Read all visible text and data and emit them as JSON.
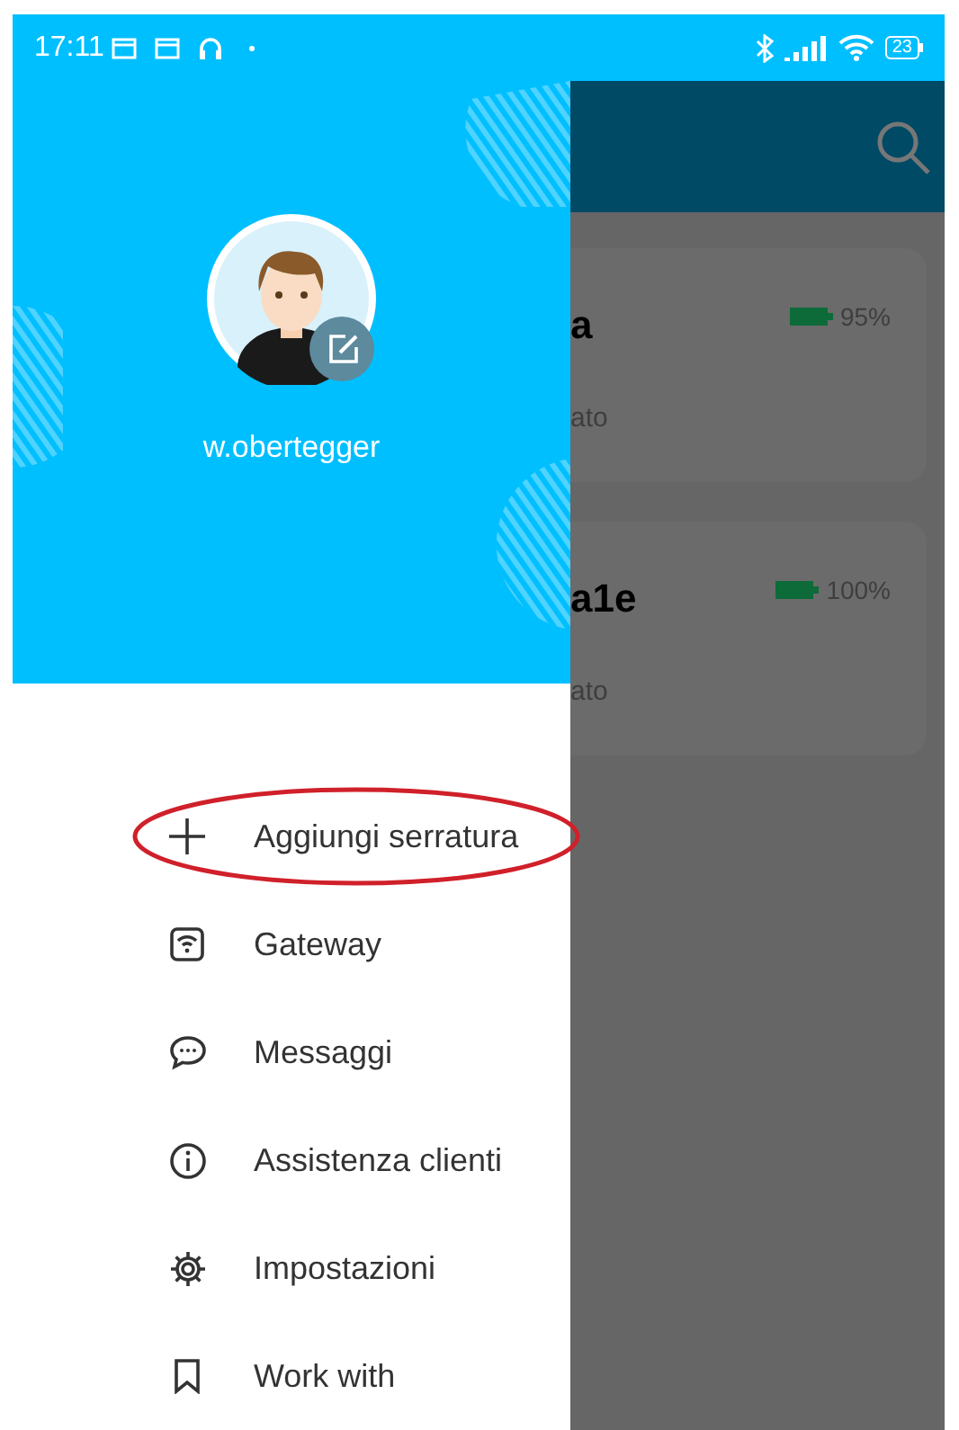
{
  "status_bar": {
    "time": "17:11",
    "battery": "23"
  },
  "drawer": {
    "username": "w.obertegger",
    "menu": [
      {
        "kind": "plus",
        "label": "Aggiungi serratura",
        "highlighted": true
      },
      {
        "kind": "gateway",
        "label": "Gateway",
        "highlighted": false
      },
      {
        "kind": "message",
        "label": "Messaggi",
        "highlighted": false
      },
      {
        "kind": "info",
        "label": "Assistenza clienti",
        "highlighted": false
      },
      {
        "kind": "gear",
        "label": "Impostazioni",
        "highlighted": false
      },
      {
        "kind": "bookmark",
        "label": "Work with",
        "highlighted": false
      }
    ]
  },
  "background_app": {
    "cards": [
      {
        "title": "a",
        "battery": "95%",
        "subtitle": "ato"
      },
      {
        "title": "a1e",
        "battery": "100%",
        "subtitle": "ato"
      }
    ]
  }
}
